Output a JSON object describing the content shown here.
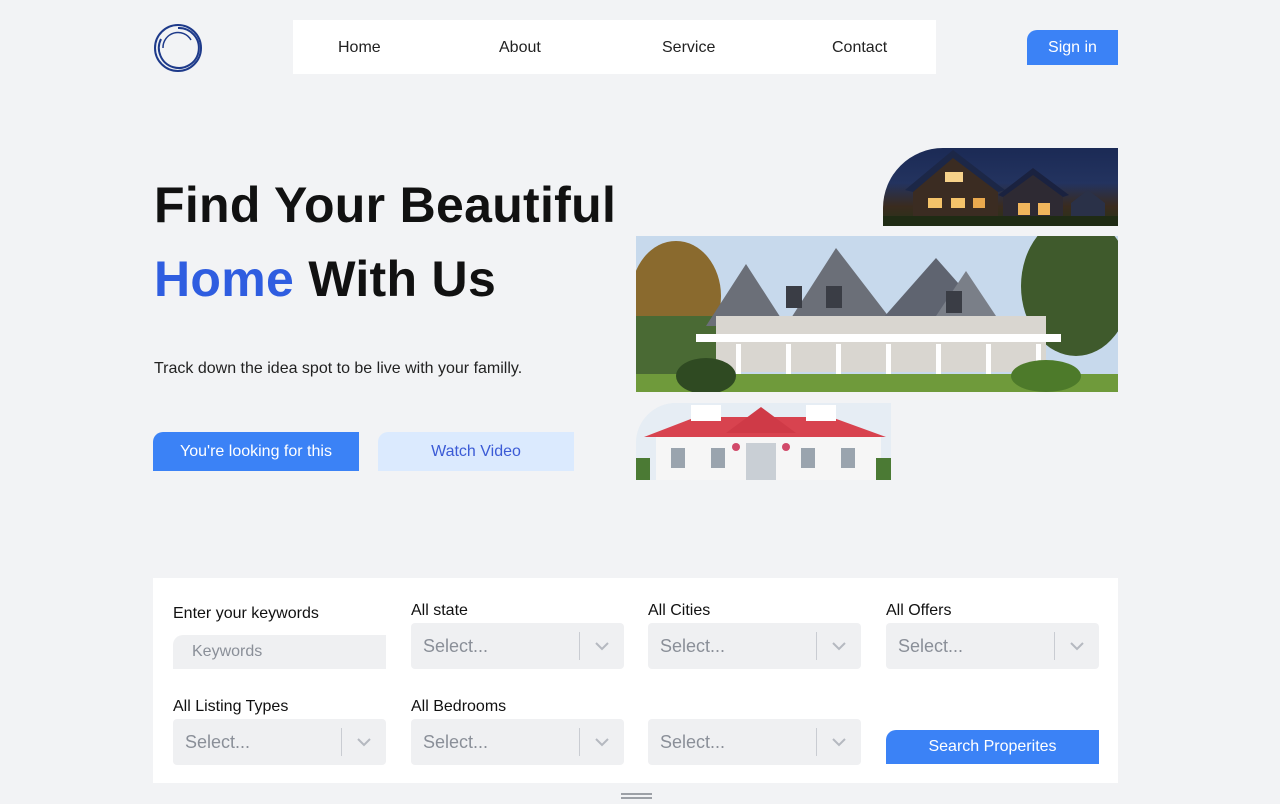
{
  "nav": {
    "items": [
      "Home",
      "About",
      "Service",
      "Contact"
    ],
    "signin_label": "Sign in"
  },
  "hero": {
    "title_line1": "Find Your Beautiful",
    "title_accent": "Home",
    "title_rest": " With Us",
    "subtitle": "Track down the idea spot to be live with your familly.",
    "primary_button": "You're looking for this",
    "secondary_button": "Watch Video"
  },
  "search": {
    "keywords_label": "Enter your keywords",
    "keywords_placeholder": "Keywords",
    "state_label": "All state",
    "cities_label": "All Cities",
    "offers_label": "All Offers",
    "listing_types_label": "All Listing Types",
    "bedrooms_label": "All Bedrooms",
    "select_placeholder": "Select...",
    "submit_label": "Search Properites"
  },
  "colors": {
    "accent": "#3b82f6",
    "heading_accent": "#2f5de0",
    "secondary_button_bg": "#dbeafe",
    "page_bg": "#f2f3f5"
  },
  "icons": [
    "logo-ring-icon",
    "chevron-down-icon"
  ]
}
